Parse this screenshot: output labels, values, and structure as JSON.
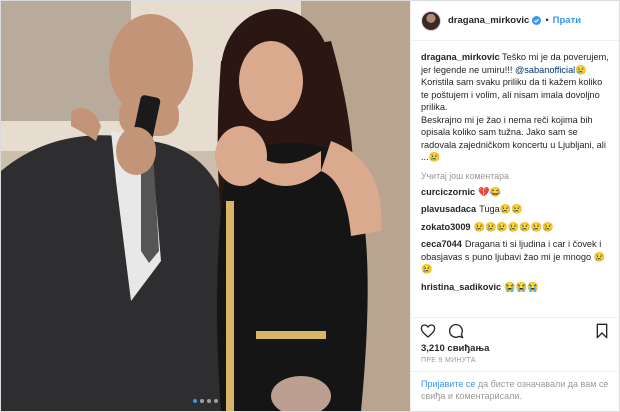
{
  "post": {
    "photo_alt_icon": "photo",
    "carousel_dots": 4,
    "carousel_active": 0
  },
  "header": {
    "username": "dragana_mirkovic",
    "separator": "•",
    "follow_label": "Прати"
  },
  "caption": {
    "username": "dragana_mirkovic",
    "line1": "Teško mi je da poverujem, jer legende ne umiru!!!",
    "mention": "@sabanofficial",
    "emoji1": "😢",
    "text2": "Koristila sam svaku priliku da ti kažem koliko te poštujem i volim, ali nisam imala dovoljno prilika.",
    "text3": "Beskrajno mi je žao i nema reči kojima bih opisala koliko sam tužna. Jako sam se radovala zajedničkom koncertu u Ljubljani, ali ...",
    "emoji2": "😢"
  },
  "load_more": "Учитај још коментара",
  "comments": [
    {
      "user": "curciczornic",
      "text": "💔😂"
    },
    {
      "user": "plavusadaca",
      "text": "Tuga😢😢"
    },
    {
      "user": "zokato3009",
      "text": "😢😢😢😢😢😢😢"
    },
    {
      "user": "ceca7044",
      "text": "Dragana ti si ljudina i car i čovek i obasjavas s puno ljubavi žao mi je mnogo 😢😢"
    },
    {
      "user": "hristina_sadikovic",
      "text": "😭😭😭"
    }
  ],
  "likes": "3,210 свиђања",
  "time_ago": "ПРЕ 9 МИНУТА",
  "login": {
    "link": "Пријавите се",
    "rest": " да бисте означавали да вам се свиђа и коментарисали."
  },
  "colors": {
    "link_blue": "#3897f0",
    "muted": "#999999",
    "text": "#262626"
  }
}
